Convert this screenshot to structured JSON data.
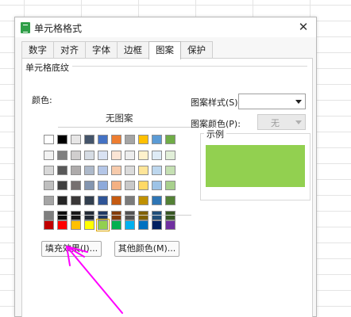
{
  "dialog": {
    "title": "单元格格式",
    "close_symbol": "✕"
  },
  "tabs": [
    {
      "label": "数字"
    },
    {
      "label": "对齐"
    },
    {
      "label": "字体"
    },
    {
      "label": "边框"
    },
    {
      "label": "图案",
      "active": true
    },
    {
      "label": "保护"
    }
  ],
  "shading": {
    "group_label": "单元格底纹",
    "color_label": "颜色:",
    "no_pattern_label": "无图案",
    "selected_color": "#92D050",
    "row_basic": [
      "#FFFFFF",
      "#000000",
      "#E7E6E6",
      "#44546A",
      "#4472C4",
      "#ED7D31",
      "#A5A5A5",
      "#FFC000",
      "#5B9BD5",
      "#70AD47"
    ],
    "tint_rows": [
      [
        "#F2F2F2",
        "#7F7F7F",
        "#D0CECE",
        "#D6DCE4",
        "#D9E2F3",
        "#FBE5D5",
        "#EDEDED",
        "#FFF2CC",
        "#DEEBF6",
        "#E2EFD9"
      ],
      [
        "#D8D8D8",
        "#595959",
        "#AEABAB",
        "#ADB9CA",
        "#B4C6E7",
        "#F7CBAC",
        "#DBDBDB",
        "#FEE599",
        "#BDD7EE",
        "#C5E0B3"
      ],
      [
        "#BFBFBF",
        "#3F3F3F",
        "#757070",
        "#8496B0",
        "#8EAADB",
        "#F4B183",
        "#C9C9C9",
        "#FFD966",
        "#9DC3E6",
        "#A8D08D"
      ],
      [
        "#A5A5A5",
        "#262626",
        "#3A3838",
        "#323F4F",
        "#2F5496",
        "#C55A11",
        "#7B7B7B",
        "#BF9000",
        "#2E75B5",
        "#538135"
      ],
      [
        "#7F7F7F",
        "#0C0C0C",
        "#171616",
        "#222A35",
        "#1F3864",
        "#833C0B",
        "#525252",
        "#7F6000",
        "#1F4E79",
        "#375623"
      ]
    ],
    "row_standard": [
      "#C00000",
      "#FF0000",
      "#FFC000",
      "#FFFF00",
      "#92D050",
      "#00B050",
      "#00B0F0",
      "#0070C0",
      "#002060",
      "#7030A0"
    ],
    "fill_effects_button": "填充效果(I)...",
    "more_colors_button": "其他颜色(M)..."
  },
  "pattern": {
    "style_label": "图案样式(S):",
    "style_value": "",
    "color_label": "图案颜色(P):",
    "color_value": "无"
  },
  "sample": {
    "label": "示例",
    "color": "#92D050"
  },
  "annotation": {
    "arrow_color": "#FF00FF"
  }
}
